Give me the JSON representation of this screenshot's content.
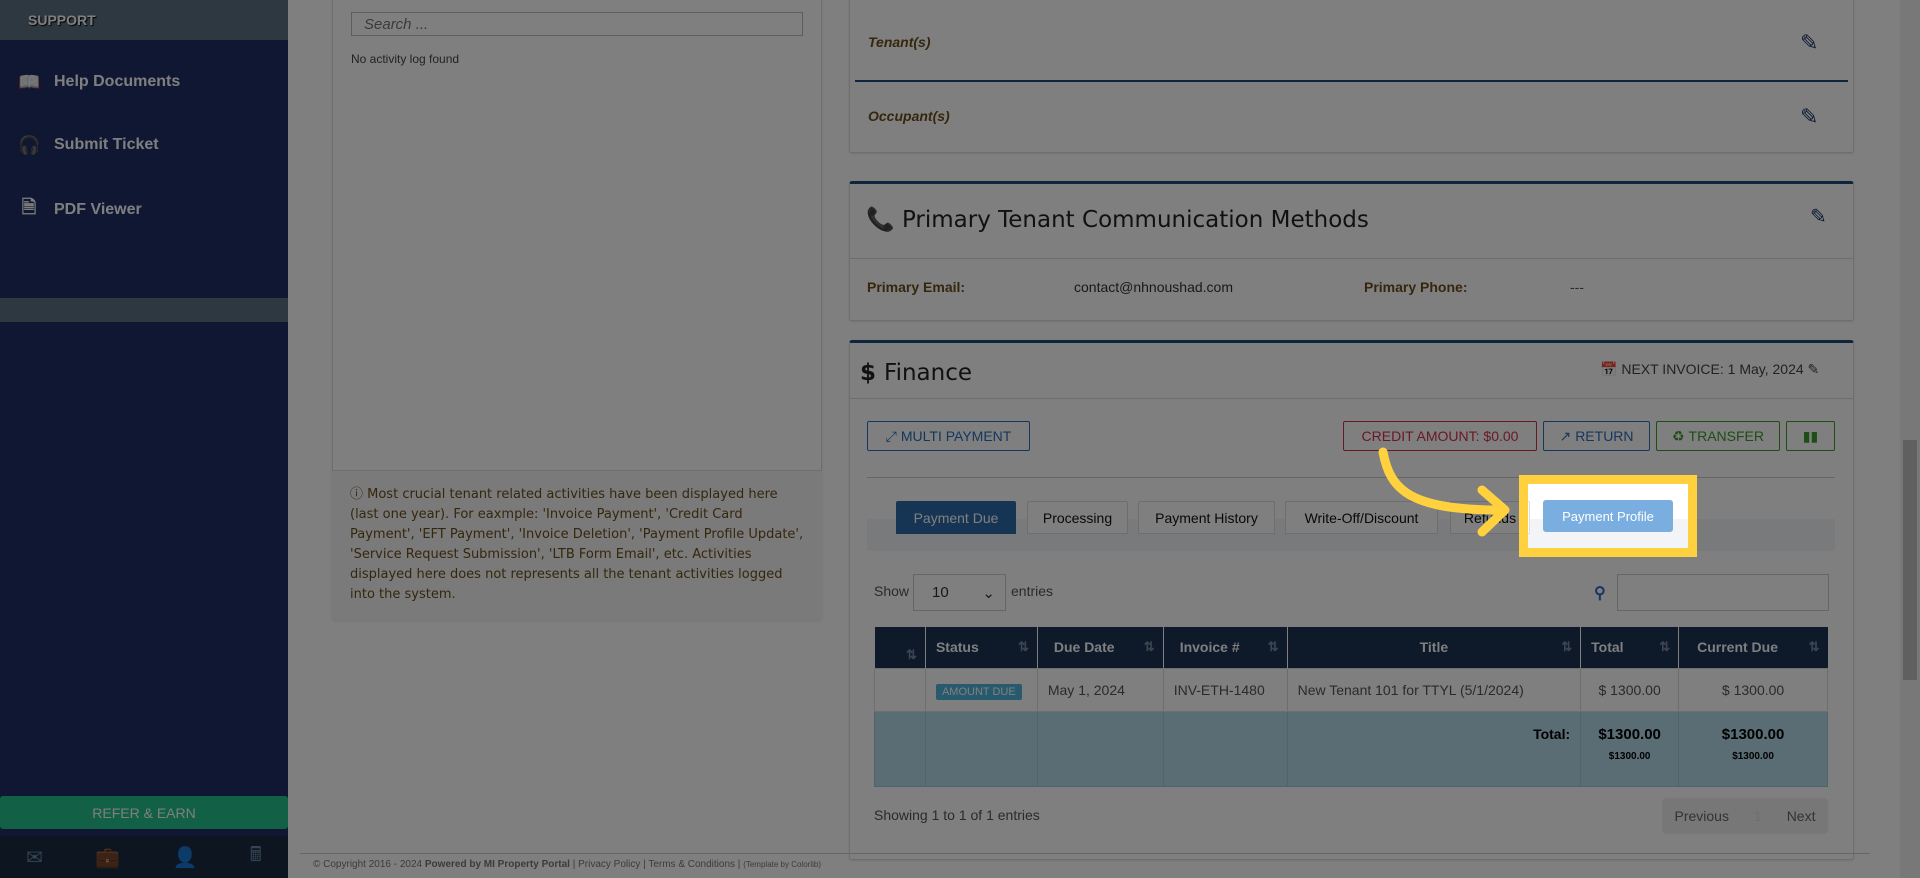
{
  "sidebar": {
    "header": "SUPPORT",
    "items": [
      {
        "label": "Help Documents",
        "icon": "book-icon"
      },
      {
        "label": "Submit Ticket",
        "icon": "headphones-icon"
      },
      {
        "label": "PDF Viewer",
        "icon": "pdf-icon"
      }
    ],
    "refer": "REFER & EARN",
    "bottom_icons": [
      "envelope-icon",
      "briefcase-icon",
      "user-icon",
      "calculator-icon"
    ]
  },
  "activity": {
    "search_placeholder": "Search ...",
    "empty": "No activity log found",
    "info": "Most crucial tenant related activities have been displayed here (last one year). For eaxmple: 'Invoice Payment', 'Credit Card Payment', 'EFT Payment', 'Invoice Deletion', 'Payment Profile Update', 'Service Request Submission', 'LTB Form Email', etc. Activities displayed here does not represents all the tenant activities logged into the system."
  },
  "people": {
    "tenants": "Tenant(s)",
    "occupants": "Occupant(s)"
  },
  "comm": {
    "title": "Primary Tenant Communication Methods",
    "email_label": "Primary Email:",
    "email": "contact@nhnoushad.com",
    "phone_label": "Primary Phone:",
    "phone": "---"
  },
  "finance": {
    "title": "Finance",
    "next_invoice": "NEXT INVOICE: 1 May, 2024",
    "multi_payment": "MULTI PAYMENT",
    "credit": "CREDIT AMOUNT: $0.00",
    "return": "RETURN",
    "transfer": "TRANSFER",
    "tabs": [
      "Payment Due",
      "Processing",
      "Payment History",
      "Write-Off/Discount",
      "Refunds",
      "Payment Profile"
    ],
    "show": "Show",
    "entries_value": "10",
    "entries": "entries",
    "columns": [
      "",
      "Status",
      "Due Date",
      "Invoice #",
      "Title",
      "Total",
      "Current Due"
    ],
    "row": {
      "status": "AMOUNT DUE",
      "due": "May 1, 2024",
      "invoice": "INV-ETH-1480",
      "title": "New Tenant 101 for TTYL (5/1/2024)",
      "total": "$ 1300.00",
      "current": "$ 1300.00"
    },
    "totals": {
      "label": "Total:",
      "total": "$1300.00",
      "total_sub": "$1300.00",
      "current": "$1300.00",
      "current_sub": "$1300.00"
    },
    "showing": "Showing 1 to 1 of 1 entries",
    "prev": "Previous",
    "page": "1",
    "next": "Next"
  },
  "footer": {
    "copy": "© Copyright 2016 - 2024",
    "powered": "Powered by MI Property Portal",
    "privacy": "Privacy Policy",
    "terms": "Terms & Conditions",
    "template": "(Template by Colorlib)"
  },
  "colors": {
    "highlight": "#ffd13e",
    "accent": "#1d3354"
  }
}
